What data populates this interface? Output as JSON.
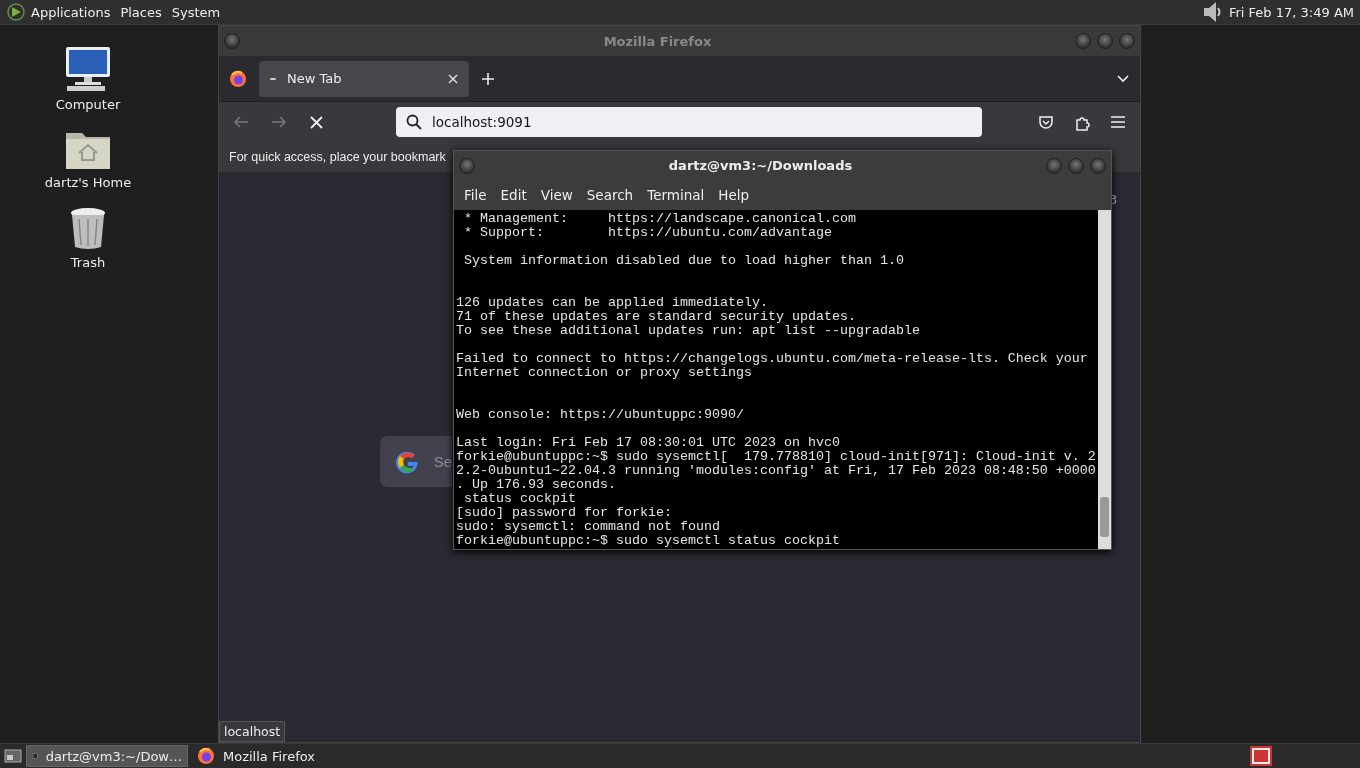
{
  "top_panel": {
    "menus": [
      "Applications",
      "Places",
      "System"
    ],
    "clock": "Fri Feb 17, 3:49 AM"
  },
  "desktop_icons": [
    {
      "label": "Computer",
      "kind": "computer"
    },
    {
      "label": "dartz's Home",
      "kind": "home"
    },
    {
      "label": "Trash",
      "kind": "trash"
    }
  ],
  "firefox": {
    "title": "Mozilla Firefox",
    "tabs": [
      {
        "label": "New Tab",
        "selected": true
      }
    ],
    "address": "localhost:9091",
    "bookmarks_hint": "For quick access, place your bookmark",
    "search_placeholder": "Se",
    "partial_text": "3",
    "status": "localhost"
  },
  "terminal": {
    "title": "dartz@vm3:~/Downloads",
    "menus": [
      "File",
      "Edit",
      "View",
      "Search",
      "Terminal",
      "Help"
    ],
    "lines": [
      {
        "kind": "text",
        "text": " * Management:     https://landscape.canonical.com"
      },
      {
        "kind": "text",
        "text": " * Support:        https://ubuntu.com/advantage"
      },
      {
        "kind": "blank"
      },
      {
        "kind": "text",
        "text": " System information disabled due to load higher than 1.0"
      },
      {
        "kind": "blank"
      },
      {
        "kind": "blank"
      },
      {
        "kind": "text",
        "text": "126 updates can be applied immediately."
      },
      {
        "kind": "text",
        "text": "71 of these updates are standard security updates."
      },
      {
        "kind": "text",
        "text": "To see these additional updates run: apt list --upgradable"
      },
      {
        "kind": "blank"
      },
      {
        "kind": "text",
        "text": "Failed to connect to https://changelogs.ubuntu.com/meta-release-lts. Check your"
      },
      {
        "kind": "text",
        "text": "Internet connection or proxy settings"
      },
      {
        "kind": "blank"
      },
      {
        "kind": "blank"
      },
      {
        "kind": "text",
        "text": "Web console: https://ubuntuppc:9090/"
      },
      {
        "kind": "blank"
      },
      {
        "kind": "text",
        "text": "Last login: Fri Feb 17 08:30:01 UTC 2023 on hvc0"
      },
      {
        "kind": "text",
        "text": "forkie@ubuntuppc:~$ sudo sysemctl[  179.778810] cloud-init[971]: Cloud-init v. 2"
      },
      {
        "kind": "text",
        "text": "2.2-0ubuntu1~22.04.3 running 'modules:config' at Fri, 17 Feb 2023 08:48:50 +0000"
      },
      {
        "kind": "text",
        "text": ". Up 176.93 seconds."
      },
      {
        "kind": "text",
        "text": " status cockpit"
      },
      {
        "kind": "text",
        "text": "[sudo] password for forkie:"
      },
      {
        "kind": "text",
        "text": "sudo: sysemctl: command not found"
      },
      {
        "kind": "text",
        "text": "forkie@ubuntuppc:~$ sudo sysemctl status cockpit"
      }
    ]
  },
  "taskbar": {
    "tasks": [
      {
        "label": "dartz@vm3:~/Dow…",
        "kind": "terminal",
        "selected": true
      },
      {
        "label": "Mozilla Firefox",
        "kind": "firefox",
        "selected": false
      }
    ]
  }
}
